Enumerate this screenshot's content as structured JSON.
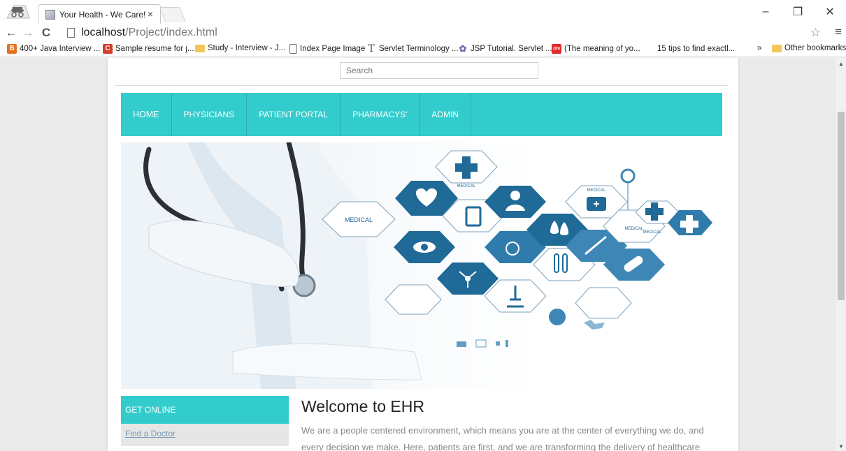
{
  "browser": {
    "tab_title": "Your Health - We Care!",
    "tab_close": "×",
    "url_host": "localhost",
    "url_path": "/Project/index.html",
    "window_controls": [
      "–",
      "❐",
      "✕"
    ]
  },
  "bookmarks": [
    {
      "label": "400+ Java Interview ...",
      "icon": "blogger-icon"
    },
    {
      "label": "Sample resume for j...",
      "icon": "c-icon"
    },
    {
      "label": "Study - Interview - J...",
      "icon": "folder-icon"
    },
    {
      "label": "Index Page Image",
      "icon": "page-icon"
    },
    {
      "label": "Servlet Terminology ...",
      "icon": "t-icon"
    },
    {
      "label": "JSP Tutorial. Servlet ...",
      "icon": "jsp-icon"
    },
    {
      "label": "(The meaning of yo...",
      "icon": "zimbio-icon"
    },
    {
      "label": "15 tips to find exactl...",
      "icon": "blank-icon"
    }
  ],
  "bookmarks_overflow": "»",
  "other_bookmarks": "Other bookmarks",
  "site": {
    "search_placeholder": "Search",
    "nav": [
      "HOME",
      "PHYSICIANS",
      "PATIENT PORTAL",
      "PHARMACYS'",
      "ADMIN"
    ],
    "hero_labels": [
      "MEDICAL",
      "MEDICAL",
      "MEDICAL",
      "MEDICAL",
      "MEDICAL",
      "MEDICAL"
    ],
    "sidebar_heading": "GET ONLINE",
    "sidebar_link": "Find a Doctor",
    "welcome_title": "Welcome to EHR",
    "welcome_text": "We are a people centered environment, which means you are at the center of everything we do, and every decision we make. Here, patients are first, and we are transforming the delivery of healthcare"
  },
  "colors": {
    "accent": "#33cccc",
    "hex_dark": "#1f6a96",
    "hex_mid": "#3d86b5",
    "link": "#7a9ab7"
  }
}
